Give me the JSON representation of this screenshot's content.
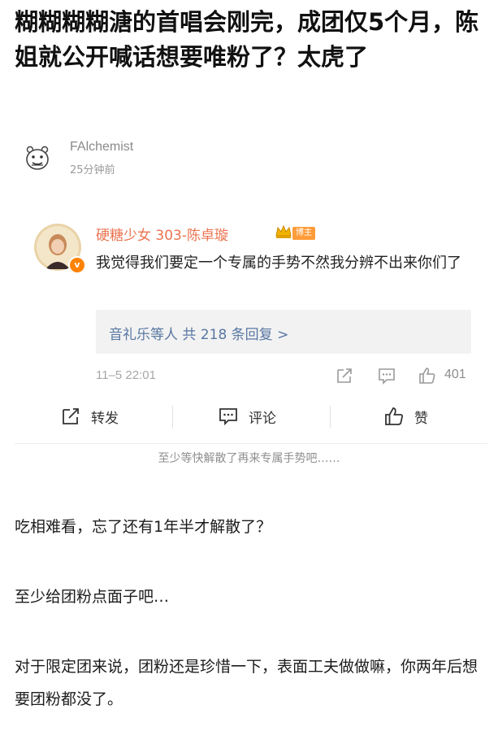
{
  "article": {
    "title": "糊糊糊糊溏的首唱会刚完，成团仅5个月，陈姐就公开喊话想要唯粉了？太虎了"
  },
  "author": {
    "name": "FAlchemist",
    "time": "25分钟前",
    "avatar_icon": "cartoon-face-icon"
  },
  "embedded_comment": {
    "username": "硬糖少女 303-陈卓璇",
    "crown_icon": "crown-icon",
    "badge": "博主",
    "verified_icon": "verified-v-icon",
    "verified_mark": "v",
    "text": "我觉得我们要定一个专属的手势不然我分辨不出来你们了",
    "reply_summary": "音礼乐等人 共 218 条回复 >",
    "date": "11–5 22:01",
    "like_count": "401",
    "actions": {
      "repost": "转发",
      "comment": "评论",
      "like": "赞"
    }
  },
  "caption": "至少等快解散了再来专属手势吧……",
  "paragraphs": [
    "吃相难看，忘了还有1年半才解散了？",
    "至少给团粉点面子吧…",
    "对于限定团来说，团粉还是珍惜一下，表面工夫做做嘛，你两年后想要团粉都没了。"
  ],
  "colors": {
    "username": "#eb7350",
    "link": "#5877a3",
    "badge": "#ff9c3a",
    "verified": "#ff8200"
  }
}
